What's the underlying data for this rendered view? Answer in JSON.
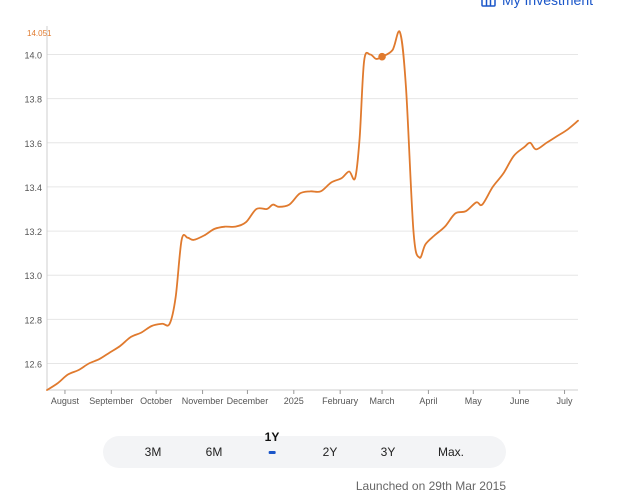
{
  "header": {
    "link_label": "My Investment",
    "icon": "portfolio-icon"
  },
  "chart_data": {
    "type": "line",
    "title": "",
    "xlabel": "",
    "ylabel": "",
    "ylim": [
      12.48,
      14.12
    ],
    "yticks": [
      12.6,
      12.8,
      13.0,
      13.2,
      13.4,
      13.6,
      13.8,
      14.0
    ],
    "yticklabels": [
      "12.6",
      "12.8",
      "13.0",
      "13.2",
      "13.4",
      "13.6",
      "13.8",
      "14.0"
    ],
    "xlim": [
      "2024-07-20",
      "2025-07-10"
    ],
    "xticks": [
      {
        "date": "2024-08-01",
        "label": "August"
      },
      {
        "date": "2024-09-01",
        "label": "September"
      },
      {
        "date": "2024-10-01",
        "label": "October"
      },
      {
        "date": "2024-11-01",
        "label": "November"
      },
      {
        "date": "2024-12-01",
        "label": "December"
      },
      {
        "date": "2025-01-01",
        "label": "2025"
      },
      {
        "date": "2025-02-01",
        "label": "February"
      },
      {
        "date": "2025-03-01",
        "label": "March"
      },
      {
        "date": "2025-04-01",
        "label": "April"
      },
      {
        "date": "2025-05-01",
        "label": "May"
      },
      {
        "date": "2025-06-01",
        "label": "June"
      },
      {
        "date": "2025-07-01",
        "label": "July"
      }
    ],
    "max_label": "14.051",
    "grid": true,
    "series": [
      {
        "color": "#e07a2e",
        "highlight": {
          "date": "2025-03-01",
          "value": 13.99
        },
        "points": [
          [
            "2024-07-20",
            12.48
          ],
          [
            "2024-07-27",
            12.51
          ],
          [
            "2024-08-03",
            12.55
          ],
          [
            "2024-08-10",
            12.57
          ],
          [
            "2024-08-17",
            12.6
          ],
          [
            "2024-08-24",
            12.62
          ],
          [
            "2024-08-31",
            12.65
          ],
          [
            "2024-09-07",
            12.68
          ],
          [
            "2024-09-14",
            12.72
          ],
          [
            "2024-09-21",
            12.74
          ],
          [
            "2024-09-28",
            12.77
          ],
          [
            "2024-10-05",
            12.78
          ],
          [
            "2024-10-10",
            12.78
          ],
          [
            "2024-10-14",
            12.9
          ],
          [
            "2024-10-18",
            13.16
          ],
          [
            "2024-10-22",
            13.17
          ],
          [
            "2024-10-26",
            13.16
          ],
          [
            "2024-11-02",
            13.18
          ],
          [
            "2024-11-09",
            13.21
          ],
          [
            "2024-11-16",
            13.22
          ],
          [
            "2024-11-23",
            13.22
          ],
          [
            "2024-11-30",
            13.24
          ],
          [
            "2024-12-07",
            13.3
          ],
          [
            "2024-12-14",
            13.3
          ],
          [
            "2024-12-18",
            13.32
          ],
          [
            "2024-12-22",
            13.31
          ],
          [
            "2024-12-29",
            13.32
          ],
          [
            "2025-01-05",
            13.37
          ],
          [
            "2025-01-12",
            13.38
          ],
          [
            "2025-01-19",
            13.38
          ],
          [
            "2025-01-26",
            13.42
          ],
          [
            "2025-02-02",
            13.44
          ],
          [
            "2025-02-07",
            13.47
          ],
          [
            "2025-02-11",
            13.44
          ],
          [
            "2025-02-14",
            13.62
          ],
          [
            "2025-02-17",
            13.97
          ],
          [
            "2025-02-21",
            14.0
          ],
          [
            "2025-02-25",
            13.98
          ],
          [
            "2025-03-01",
            13.99
          ],
          [
            "2025-03-08",
            14.02
          ],
          [
            "2025-03-13",
            14.1
          ],
          [
            "2025-03-17",
            13.85
          ],
          [
            "2025-03-22",
            13.2
          ],
          [
            "2025-03-26",
            13.08
          ],
          [
            "2025-03-30",
            13.14
          ],
          [
            "2025-04-05",
            13.18
          ],
          [
            "2025-04-12",
            13.22
          ],
          [
            "2025-04-19",
            13.28
          ],
          [
            "2025-04-26",
            13.29
          ],
          [
            "2025-05-03",
            13.33
          ],
          [
            "2025-05-07",
            13.32
          ],
          [
            "2025-05-14",
            13.4
          ],
          [
            "2025-05-21",
            13.46
          ],
          [
            "2025-05-28",
            13.54
          ],
          [
            "2025-06-04",
            13.58
          ],
          [
            "2025-06-08",
            13.6
          ],
          [
            "2025-06-12",
            13.57
          ],
          [
            "2025-06-19",
            13.6
          ],
          [
            "2025-06-26",
            13.63
          ],
          [
            "2025-07-03",
            13.66
          ],
          [
            "2025-07-10",
            13.7
          ]
        ]
      }
    ]
  },
  "range_selector": {
    "active": "1Y",
    "options": [
      "3M",
      "6M",
      "1Y",
      "2Y",
      "3Y",
      "Max."
    ]
  },
  "footer": {
    "launch_text": "Launched on 29th Mar 2015"
  }
}
